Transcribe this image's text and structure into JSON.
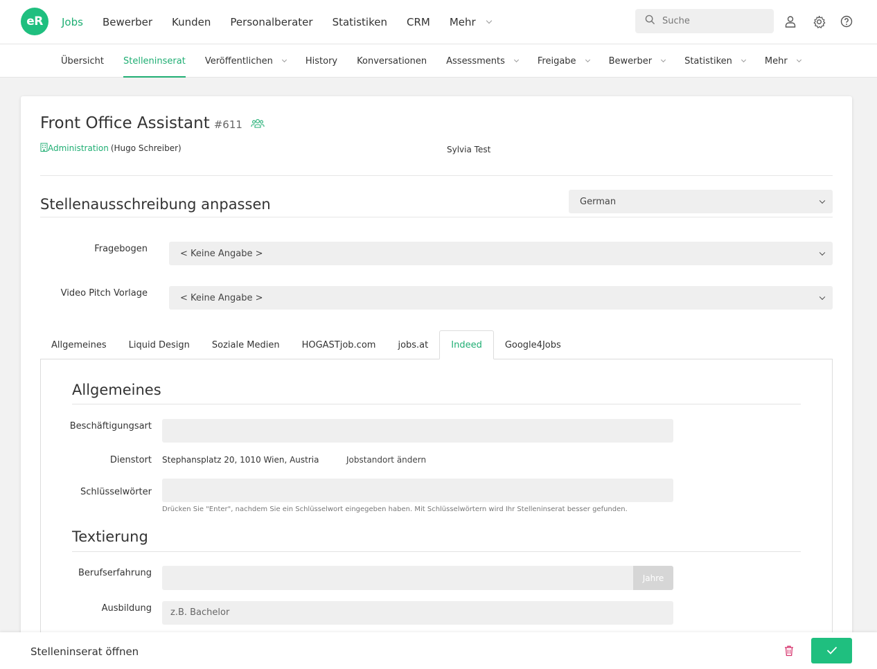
{
  "app": {
    "logo_text": "eR",
    "accent_color": "#1fbf7f"
  },
  "mainnav": [
    {
      "label": "Jobs",
      "active": true
    },
    {
      "label": "Bewerber"
    },
    {
      "label": "Kunden"
    },
    {
      "label": "Personalberater"
    },
    {
      "label": "Statistiken"
    },
    {
      "label": "CRM"
    },
    {
      "label": "Mehr",
      "dropdown": true
    }
  ],
  "search": {
    "placeholder": "Suche",
    "icon": "search-icon"
  },
  "top_icons": [
    "user-icon",
    "gear-icon",
    "help-icon"
  ],
  "subnav": [
    {
      "label": "Übersicht"
    },
    {
      "label": "Stelleninserat",
      "active": true
    },
    {
      "label": "Veröffentlichen",
      "dropdown": true
    },
    {
      "label": "History"
    },
    {
      "label": "Konversationen"
    },
    {
      "label": "Assessments",
      "dropdown": true
    },
    {
      "label": "Freigabe",
      "dropdown": true
    },
    {
      "label": "Bewerber",
      "dropdown": true
    },
    {
      "label": "Statistiken",
      "dropdown": true
    },
    {
      "label": "Mehr",
      "dropdown": true
    }
  ],
  "job": {
    "title": "Front Office Assistant",
    "id": "#611",
    "department": "Administration",
    "owner": "(Hugo Schreiber)",
    "person": "Sylvia Test"
  },
  "customize": {
    "title": "Stellenausschreibung anpassen",
    "language": "German",
    "fragebogen_label": "Fragebogen",
    "fragebogen_value": "< Keine Angabe >",
    "video_label": "Video Pitch Vorlage",
    "video_value": "< Keine Angabe >"
  },
  "tabs": [
    {
      "label": "Allgemeines"
    },
    {
      "label": "Liquid Design"
    },
    {
      "label": "Soziale Medien"
    },
    {
      "label": "HOGASTjob.com"
    },
    {
      "label": "jobs.at"
    },
    {
      "label": "Indeed",
      "active": true
    },
    {
      "label": "Google4Jobs"
    }
  ],
  "indeed": {
    "section1": "Allgemeines",
    "beschaeftigungsart_label": "Beschäftigungsart",
    "beschaeftigungsart_value": "",
    "dienstort_label": "Dienstort",
    "dienstort_value": "Stephansplatz 20, 1010 Wien, Austria",
    "dienstort_change": "Jobstandort ändern",
    "keywords_label": "Schlüsselwörter",
    "keywords_hint": "Drücken Sie \"Enter\", nachdem Sie ein Schlüsselwort eingegeben haben. Mit Schlüsselwörtern wird Ihr Stelleninserat besser gefunden.",
    "section2": "Textierung",
    "experience_label": "Berufserfahrung",
    "experience_addon": "Jahre",
    "education_label": "Ausbildung",
    "education_placeholder": "z.B. Bachelor"
  },
  "footer": {
    "text": "Stelleninserat öffnen",
    "delete_icon": "trash-icon",
    "confirm_icon": "check-icon",
    "delete_color": "#d6336c"
  }
}
